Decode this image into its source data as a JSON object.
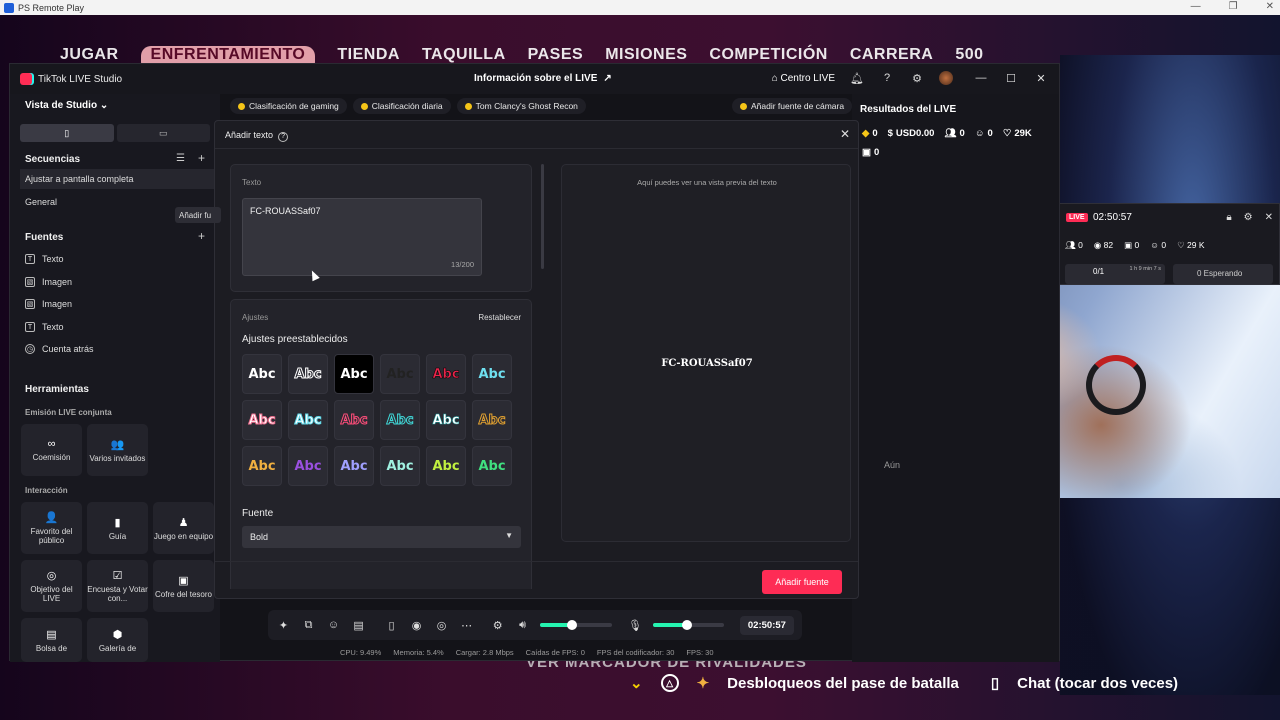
{
  "ps": {
    "title": "PS Remote Play",
    "controls": [
      "—",
      "❐",
      "✕"
    ]
  },
  "game": {
    "nav": [
      "JUGAR",
      "ENFRENTAMIENTO",
      "TIENDA",
      "TAQUILLA",
      "PASES",
      "MISIONES",
      "COMPETICIÓN",
      "CARRERA",
      "500"
    ],
    "rivalry": "VER MARCADOR DE RIVALIDADES",
    "bottom_left": "Desbloqueos del pase de batalla",
    "bottom_right": "Chat (tocar dos veces)"
  },
  "tiktok": {
    "app_name": "TikTok LIVE Studio",
    "live_info": "Información sobre el LIVE",
    "live_center": "Centro LIVE",
    "studio_view": "Vista de Studio",
    "sequences": {
      "title": "Secuencias",
      "items": [
        "Ajustar a pantalla completa",
        "General"
      ]
    },
    "tooltip": "Añadir fu",
    "sources": {
      "title": "Fuentes",
      "items": [
        {
          "label": "Texto",
          "icon": "T"
        },
        {
          "label": "Imagen",
          "icon": "▧"
        },
        {
          "label": "Imagen",
          "icon": "▧"
        },
        {
          "label": "Texto",
          "icon": "T"
        },
        {
          "label": "Cuenta atrás",
          "icon": "◷"
        }
      ]
    },
    "tools": {
      "title": "Herramientas",
      "joint_live": "Emisión LIVE conjunta",
      "joint_items": [
        {
          "label": "Coemisión",
          "icon": "∞"
        },
        {
          "label": "Varios invitados",
          "icon": "👥"
        }
      ],
      "interaction": "Interacción",
      "interaction_items": [
        {
          "label": "Favorito del público",
          "icon": "👤"
        },
        {
          "label": "Guía",
          "icon": "▮"
        },
        {
          "label": "Juego en equipo",
          "icon": "♟"
        },
        {
          "label": "Objetivo del LIVE",
          "icon": "◎"
        },
        {
          "label": "Encuesta y Votar con...",
          "icon": "☑"
        },
        {
          "label": "Cofre del tesoro",
          "icon": "▣"
        },
        {
          "label": "Bolsa de",
          "icon": "▤"
        },
        {
          "label": "Galería de",
          "icon": "⬢"
        }
      ]
    },
    "chips": [
      "Clasificación de gaming",
      "Clasificación diaria",
      "Tom Clancy's Ghost Recon"
    ],
    "camera_chip": "Añadir fuente de cámara",
    "results": {
      "title": "Resultados del LIVE",
      "stats": [
        "0",
        "USD0.00",
        "0",
        "0",
        "29K",
        "0"
      ],
      "aun": "Aún"
    },
    "bottom_timer": "02:50:57",
    "status": [
      "CPU: 9.49%",
      "Memoria: 5.4%",
      "Cargar: 2.8 Mbps",
      "Caídas de FPS: 0",
      "FPS del codificador: 30",
      "FPS: 30"
    ]
  },
  "modal": {
    "title": "Añadir texto",
    "text_label": "Texto",
    "text_value": "FC-ROUASSaf07",
    "counter": "13/200",
    "settings_label": "Ajustes",
    "reset": "Restablecer",
    "presets_label": "Ajustes preestablecidos",
    "preset_text": "Abc",
    "font_label": "Fuente",
    "font_value": "Bold",
    "preview_hint": "Aquí puedes ver una vista previa del texto",
    "preview_text": "FC-ROUASSaf07",
    "add_button": "Añadir fuente"
  },
  "live_widget": {
    "tag": "LIVE",
    "time": "02:50:57",
    "stats": [
      "0",
      "82",
      "0",
      "0",
      "29 K"
    ],
    "match": "0/1",
    "match_time": "1 h 9 min 7 s",
    "waiting": "0 Esperando"
  },
  "colors": {
    "accent": "#fe2c55",
    "slider": "#25f4b0"
  },
  "levels": {
    "speaker_volume": 0.45,
    "mic_volume": 0.48
  }
}
